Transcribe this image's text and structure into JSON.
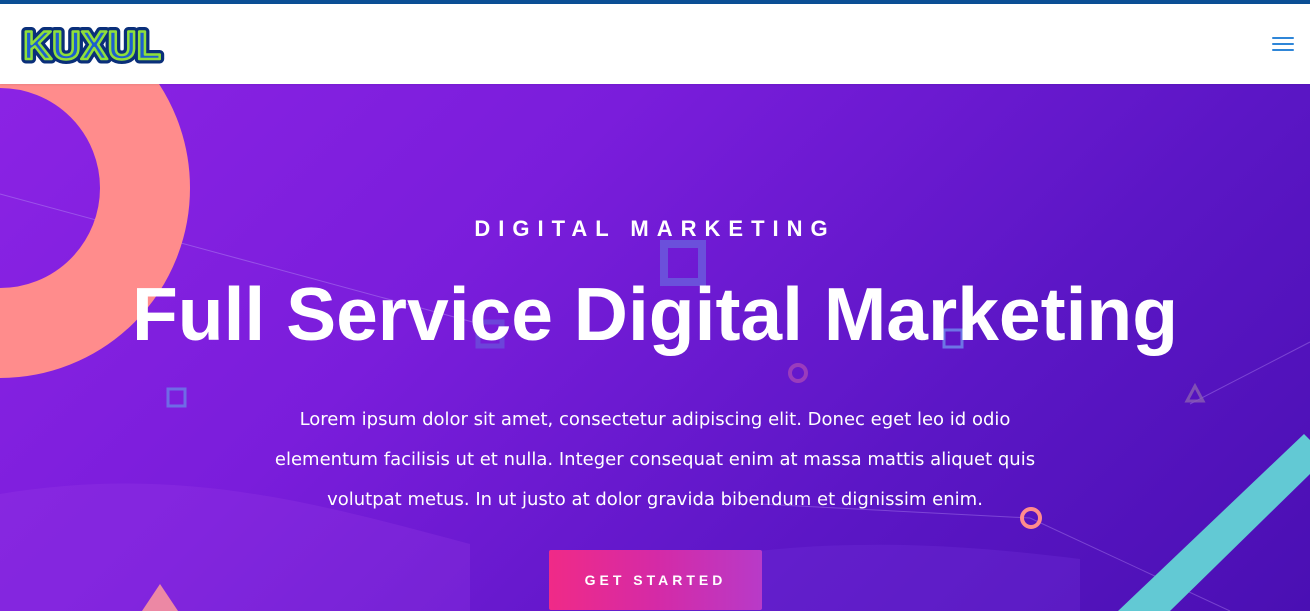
{
  "header": {
    "logo_text": "KUXUL",
    "menu_icon": "hamburger-menu-icon"
  },
  "hero": {
    "eyebrow": "DIGITAL MARKETING",
    "title": "Full Service Digital Marketing",
    "description": "Lorem ipsum dolor sit amet, consectetur adipiscing elit. Donec eget leo id odio elementum facilisis ut et nulla. Integer consequat enim at massa mattis aliquet quis volutpat metus. In ut justo at dolor gravida bibendum et dignissim enim.",
    "cta_label": "GET STARTED"
  },
  "colors": {
    "top_strip": "#0b4f95",
    "hero_gradient_start": "#8b23e4",
    "hero_gradient_end": "#4a0fb3",
    "salmon_ring": "#ff8c8c",
    "teal_band": "#62c9d4",
    "cta_start": "#f02a87",
    "cta_end": "#b83ac8",
    "menu_icon": "#2f86d8"
  }
}
